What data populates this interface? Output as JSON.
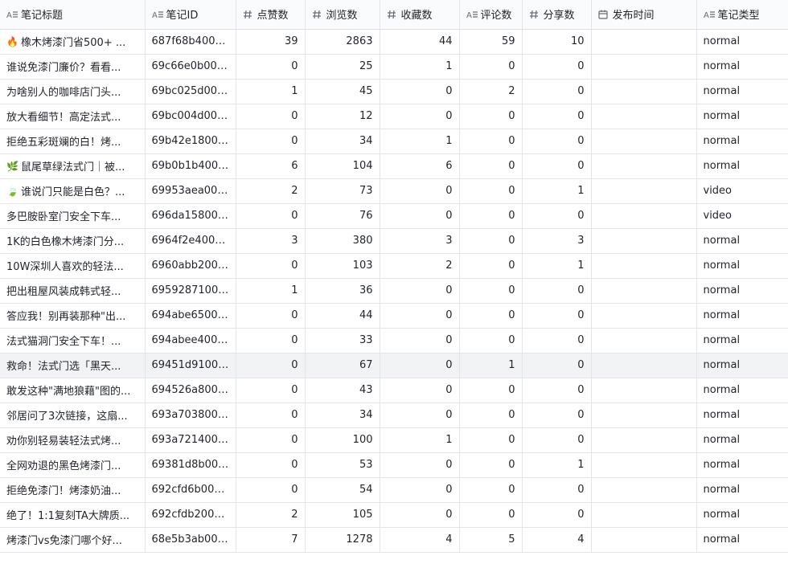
{
  "columns": [
    {
      "label": "笔记标题",
      "icon": "text-field-icon"
    },
    {
      "label": "笔记ID",
      "icon": "text-field-icon"
    },
    {
      "label": "点赞数",
      "icon": "number-field-icon"
    },
    {
      "label": "浏览数",
      "icon": "number-field-icon"
    },
    {
      "label": "收藏数",
      "icon": "number-field-icon"
    },
    {
      "label": "评论数",
      "icon": "text-field-icon"
    },
    {
      "label": "分享数",
      "icon": "number-field-icon"
    },
    {
      "label": "发布时间",
      "icon": "calendar-field-icon"
    },
    {
      "label": "笔记类型",
      "icon": "text-field-icon"
    }
  ],
  "rows": [
    {
      "emoji": "🔥",
      "emoji_icon": "fire-icon",
      "title": "橡木烤漆门省500+ ...",
      "id": "687f68b4000...",
      "likes": "39",
      "views": "2863",
      "saves": "44",
      "comments": "59",
      "shares": "10",
      "date": "",
      "type": "normal"
    },
    {
      "emoji": "",
      "title": "谁说免漆门廉价？看看...",
      "id": "69c66e0b000...",
      "likes": "0",
      "views": "25",
      "saves": "1",
      "comments": "0",
      "shares": "0",
      "date": "",
      "type": "normal"
    },
    {
      "emoji": "",
      "title": "为啥别人的咖啡店门头...",
      "id": "69bc025d000...",
      "likes": "1",
      "views": "45",
      "saves": "0",
      "comments": "2",
      "shares": "0",
      "date": "",
      "type": "normal"
    },
    {
      "emoji": "",
      "title": "放大看细节！高定法式...",
      "id": "69bc004d000...",
      "likes": "0",
      "views": "12",
      "saves": "0",
      "comments": "0",
      "shares": "0",
      "date": "",
      "type": "normal"
    },
    {
      "emoji": "",
      "title": "拒绝五彩斑斓的白！烤...",
      "id": "69b42e18000...",
      "likes": "0",
      "views": "34",
      "saves": "1",
      "comments": "0",
      "shares": "0",
      "date": "",
      "type": "normal"
    },
    {
      "emoji": "🌿",
      "emoji_icon": "herb-icon",
      "title": "鼠尾草绿法式门｜被...",
      "id": "69b0b1b4000...",
      "likes": "6",
      "views": "104",
      "saves": "6",
      "comments": "0",
      "shares": "0",
      "date": "",
      "type": "normal"
    },
    {
      "emoji": "🍃",
      "emoji_icon": "leaf-icon",
      "title": "谁说门只能是白色？...",
      "id": "69953aea000...",
      "likes": "2",
      "views": "73",
      "saves": "0",
      "comments": "0",
      "shares": "1",
      "date": "",
      "type": "video"
    },
    {
      "emoji": "",
      "title": "多巴胺卧室门安全下车...",
      "id": "696da158000...",
      "likes": "0",
      "views": "76",
      "saves": "0",
      "comments": "0",
      "shares": "0",
      "date": "",
      "type": "video"
    },
    {
      "emoji": "",
      "title": "1K的白色橡木烤漆门分...",
      "id": "6964f2e4000...",
      "likes": "3",
      "views": "380",
      "saves": "3",
      "comments": "0",
      "shares": "3",
      "date": "",
      "type": "normal"
    },
    {
      "emoji": "",
      "title": "10W深圳人喜欢的轻法...",
      "id": "6960abb2000...",
      "likes": "0",
      "views": "103",
      "saves": "2",
      "comments": "0",
      "shares": "1",
      "date": "",
      "type": "normal"
    },
    {
      "emoji": "",
      "title": "把出租屋风装成韩式轻...",
      "id": "69592871000...",
      "likes": "1",
      "views": "36",
      "saves": "0",
      "comments": "0",
      "shares": "0",
      "date": "",
      "type": "normal"
    },
    {
      "emoji": "",
      "title": "答应我！别再装那种\"出...",
      "id": "694abe65000...",
      "likes": "0",
      "views": "44",
      "saves": "0",
      "comments": "0",
      "shares": "0",
      "date": "",
      "type": "normal"
    },
    {
      "emoji": "",
      "title": "法式猫洞门安全下车！...",
      "id": "694abee4000...",
      "likes": "0",
      "views": "33",
      "saves": "0",
      "comments": "0",
      "shares": "0",
      "date": "",
      "type": "normal"
    },
    {
      "emoji": "",
      "title": "救命！法式门选「黑天...",
      "id": "69451d91000...",
      "likes": "0",
      "views": "67",
      "saves": "0",
      "comments": "1",
      "shares": "0",
      "date": "",
      "type": "normal",
      "hover": true
    },
    {
      "emoji": "",
      "title": "敢发这种\"满地狼藉\"图的...",
      "id": "694526a8000...",
      "likes": "0",
      "views": "43",
      "saves": "0",
      "comments": "0",
      "shares": "0",
      "date": "",
      "type": "normal"
    },
    {
      "emoji": "",
      "title": "邻居问了3次链接，这扇...",
      "id": "693a7038000...",
      "likes": "0",
      "views": "34",
      "saves": "0",
      "comments": "0",
      "shares": "0",
      "date": "",
      "type": "normal"
    },
    {
      "emoji": "",
      "title": "劝你别轻易装轻法式烤...",
      "id": "693a7214000...",
      "likes": "0",
      "views": "100",
      "saves": "1",
      "comments": "0",
      "shares": "0",
      "date": "",
      "type": "normal"
    },
    {
      "emoji": "",
      "title": "全网劝退的黑色烤漆门...",
      "id": "69381d8b000...",
      "likes": "0",
      "views": "53",
      "saves": "0",
      "comments": "0",
      "shares": "1",
      "date": "",
      "type": "normal"
    },
    {
      "emoji": "",
      "title": "拒绝免漆门！烤漆奶油...",
      "id": "692cfd6b000...",
      "likes": "0",
      "views": "54",
      "saves": "0",
      "comments": "0",
      "shares": "0",
      "date": "",
      "type": "normal"
    },
    {
      "emoji": "",
      "title": "绝了！1:1复刻TA大牌质...",
      "id": "692cfdb2000...",
      "likes": "2",
      "views": "105",
      "saves": "0",
      "comments": "0",
      "shares": "0",
      "date": "",
      "type": "normal"
    },
    {
      "emoji": "",
      "title": "烤漆门vs免漆门哪个好...",
      "id": "68e5b3ab000...",
      "likes": "7",
      "views": "1278",
      "saves": "4",
      "comments": "5",
      "shares": "4",
      "date": "",
      "type": "normal"
    }
  ]
}
